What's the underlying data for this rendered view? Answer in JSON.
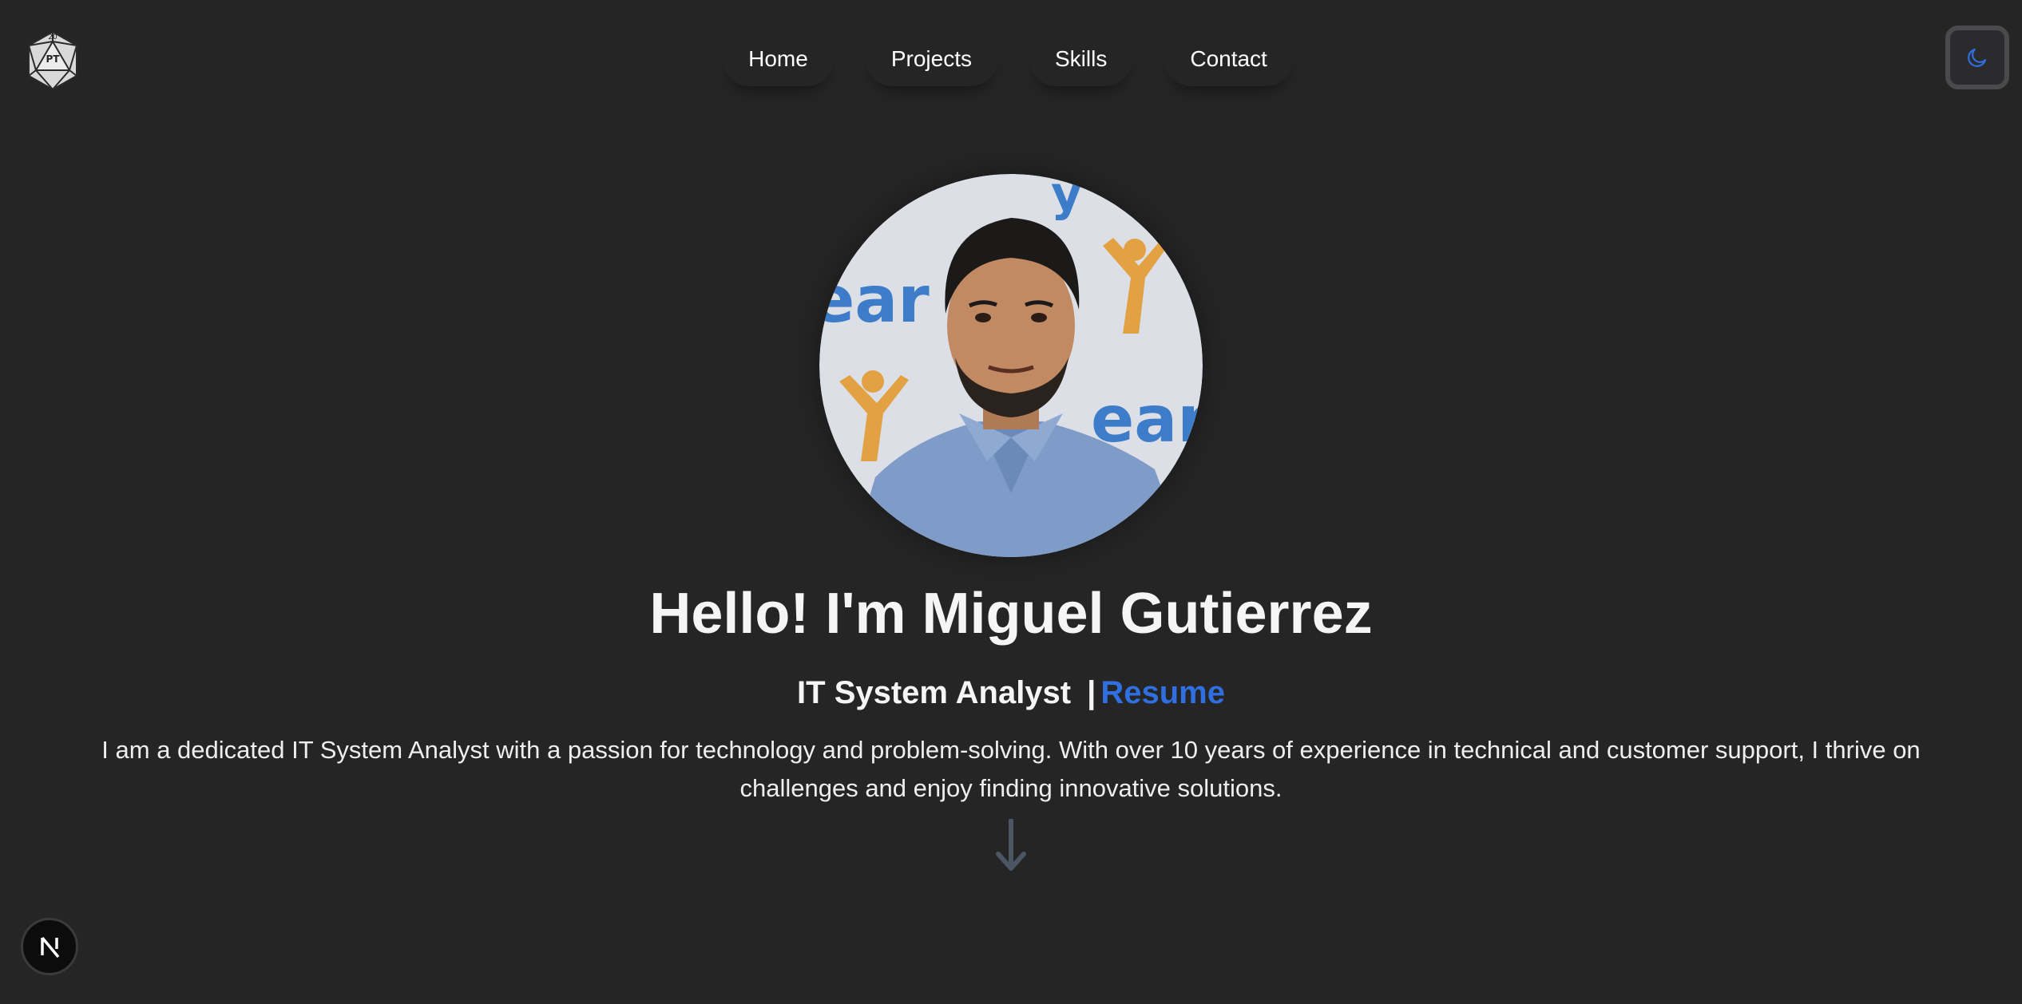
{
  "logo": {
    "icon": "d20-dice-icon",
    "text_top": "20",
    "text_mid": "PT"
  },
  "nav": {
    "items": [
      {
        "label": "Home"
      },
      {
        "label": "Projects"
      },
      {
        "label": "Skills"
      },
      {
        "label": "Contact"
      }
    ]
  },
  "theme_toggle": {
    "icon": "moon-icon",
    "accent": "#2f6fe0"
  },
  "hero": {
    "avatar_alt": "Profile photo",
    "title": "Hello! I'm Miguel Gutierrez",
    "role": "IT System Analyst",
    "separator": "|",
    "resume_link": "Resume",
    "bio": "I am a dedicated IT System Analyst with a passion for technology and problem-solving. With over 10 years of experience in technical and customer support, I thrive on challenges and enjoy finding innovative solutions.",
    "scroll_icon": "arrow-down-icon"
  },
  "framework_badge": {
    "icon": "nextjs-logo-icon"
  },
  "colors": {
    "background": "#252526",
    "text": "#f5f5f5",
    "link": "#2f6fe0",
    "arrow": "#4b5563"
  }
}
